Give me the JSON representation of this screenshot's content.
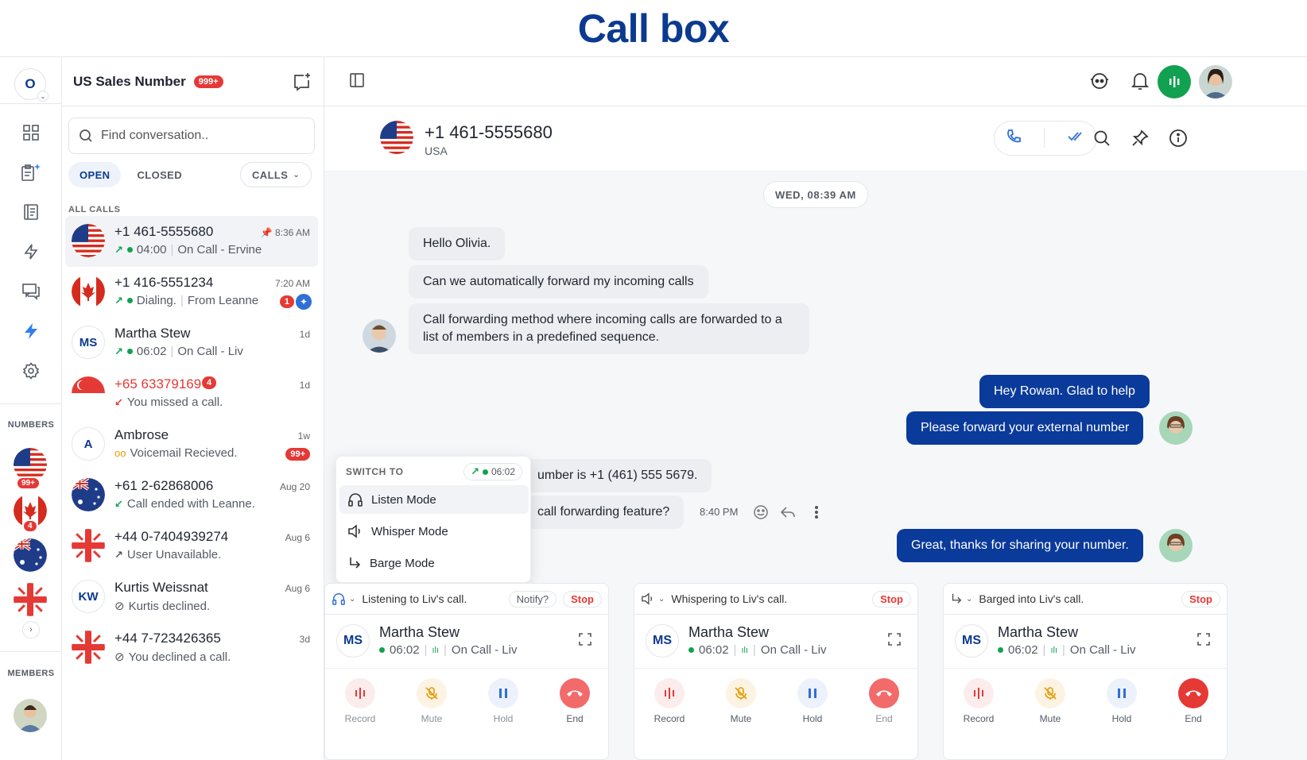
{
  "banner": {
    "title": "Call box"
  },
  "rail": {
    "org_initial": "O",
    "numbers_label": "NUMBERS",
    "members_label": "MEMBERS",
    "badges": {
      "us": "99+",
      "ca": "4"
    }
  },
  "list": {
    "title": "US Sales Number",
    "title_badge": "999+",
    "search_placeholder": "Find conversation..",
    "tabs": [
      "OPEN",
      "CLOSED"
    ],
    "calls_filter": "CALLS",
    "section": "ALL CALLS",
    "rows": [
      {
        "name": "+1 461-5555680",
        "time": "8:36 AM",
        "status": "04:00",
        "detail": "On Call - Ervine"
      },
      {
        "name": "+1 416-5551234",
        "time": "7:20 AM",
        "status": "Dialing.",
        "detail": "From Leanne",
        "count": "1"
      },
      {
        "name": "Martha Stew",
        "initials": "MS",
        "time": "1d",
        "status": "06:02",
        "detail": "On Call - Liv"
      },
      {
        "name": "+65 63379169",
        "time": "1d",
        "count": "4",
        "detail": "You missed a call."
      },
      {
        "name": "Ambrose",
        "initials": "A",
        "time": "1w",
        "detail": "Voicemail Recieved.",
        "count": "99+"
      },
      {
        "name": "+61 2-62868006",
        "time": "Aug 20",
        "detail": "Call ended with Leanne."
      },
      {
        "name": "+44 0-7404939274",
        "time": "Aug 6",
        "detail": "User Unavailable."
      },
      {
        "name": "Kurtis Weissnat",
        "initials": "KW",
        "time": "Aug 6",
        "detail": "Kurtis declined."
      },
      {
        "name": "+44 7-723426365",
        "time": "3d",
        "detail": "You declined a call."
      }
    ]
  },
  "chat": {
    "phone": "+1 461-5555680",
    "country": "USA",
    "date": "WED, 08:39 AM",
    "msgs": {
      "m1": "Hello Olivia.",
      "m2": "Can we automatically forward my incoming calls",
      "m3": "Call forwarding method where incoming calls are forwarded to a list of members in a predefined sequence.",
      "m4": "Hey Rowan. Glad to help",
      "m5": "Please forward your external number",
      "m6": "umber is +1 (461) 555 5679.",
      "m7": "call forwarding feature?",
      "m7_time": "8:40 PM",
      "m8": "Great, thanks for sharing your number."
    }
  },
  "switch_popup": {
    "title": "SWITCH TO",
    "timer": "06:02",
    "options": [
      "Listen Mode",
      "Whisper Mode",
      "Barge Mode"
    ]
  },
  "cards": [
    {
      "mode": "Listening to Liv's call.",
      "notify": "Notify?",
      "stop": "Stop",
      "initials": "MS",
      "name": "Martha Stew",
      "timer": "06:02",
      "detail": "On Call - Liv"
    },
    {
      "mode": "Whispering to Liv's call.",
      "stop": "Stop",
      "initials": "MS",
      "name": "Martha Stew",
      "timer": "06:02",
      "detail": "On Call - Liv"
    },
    {
      "mode": "Barged into Liv's call.",
      "stop": "Stop",
      "initials": "MS",
      "name": "Martha Stew",
      "timer": "06:02",
      "detail": "On Call - Liv"
    }
  ],
  "controls": [
    "Record",
    "Mute",
    "Hold",
    "End"
  ],
  "colors": {
    "brand": "#0b3a8f",
    "bubble_out": "#0a3a9a",
    "danger": "#e53935",
    "online": "#12a150"
  }
}
